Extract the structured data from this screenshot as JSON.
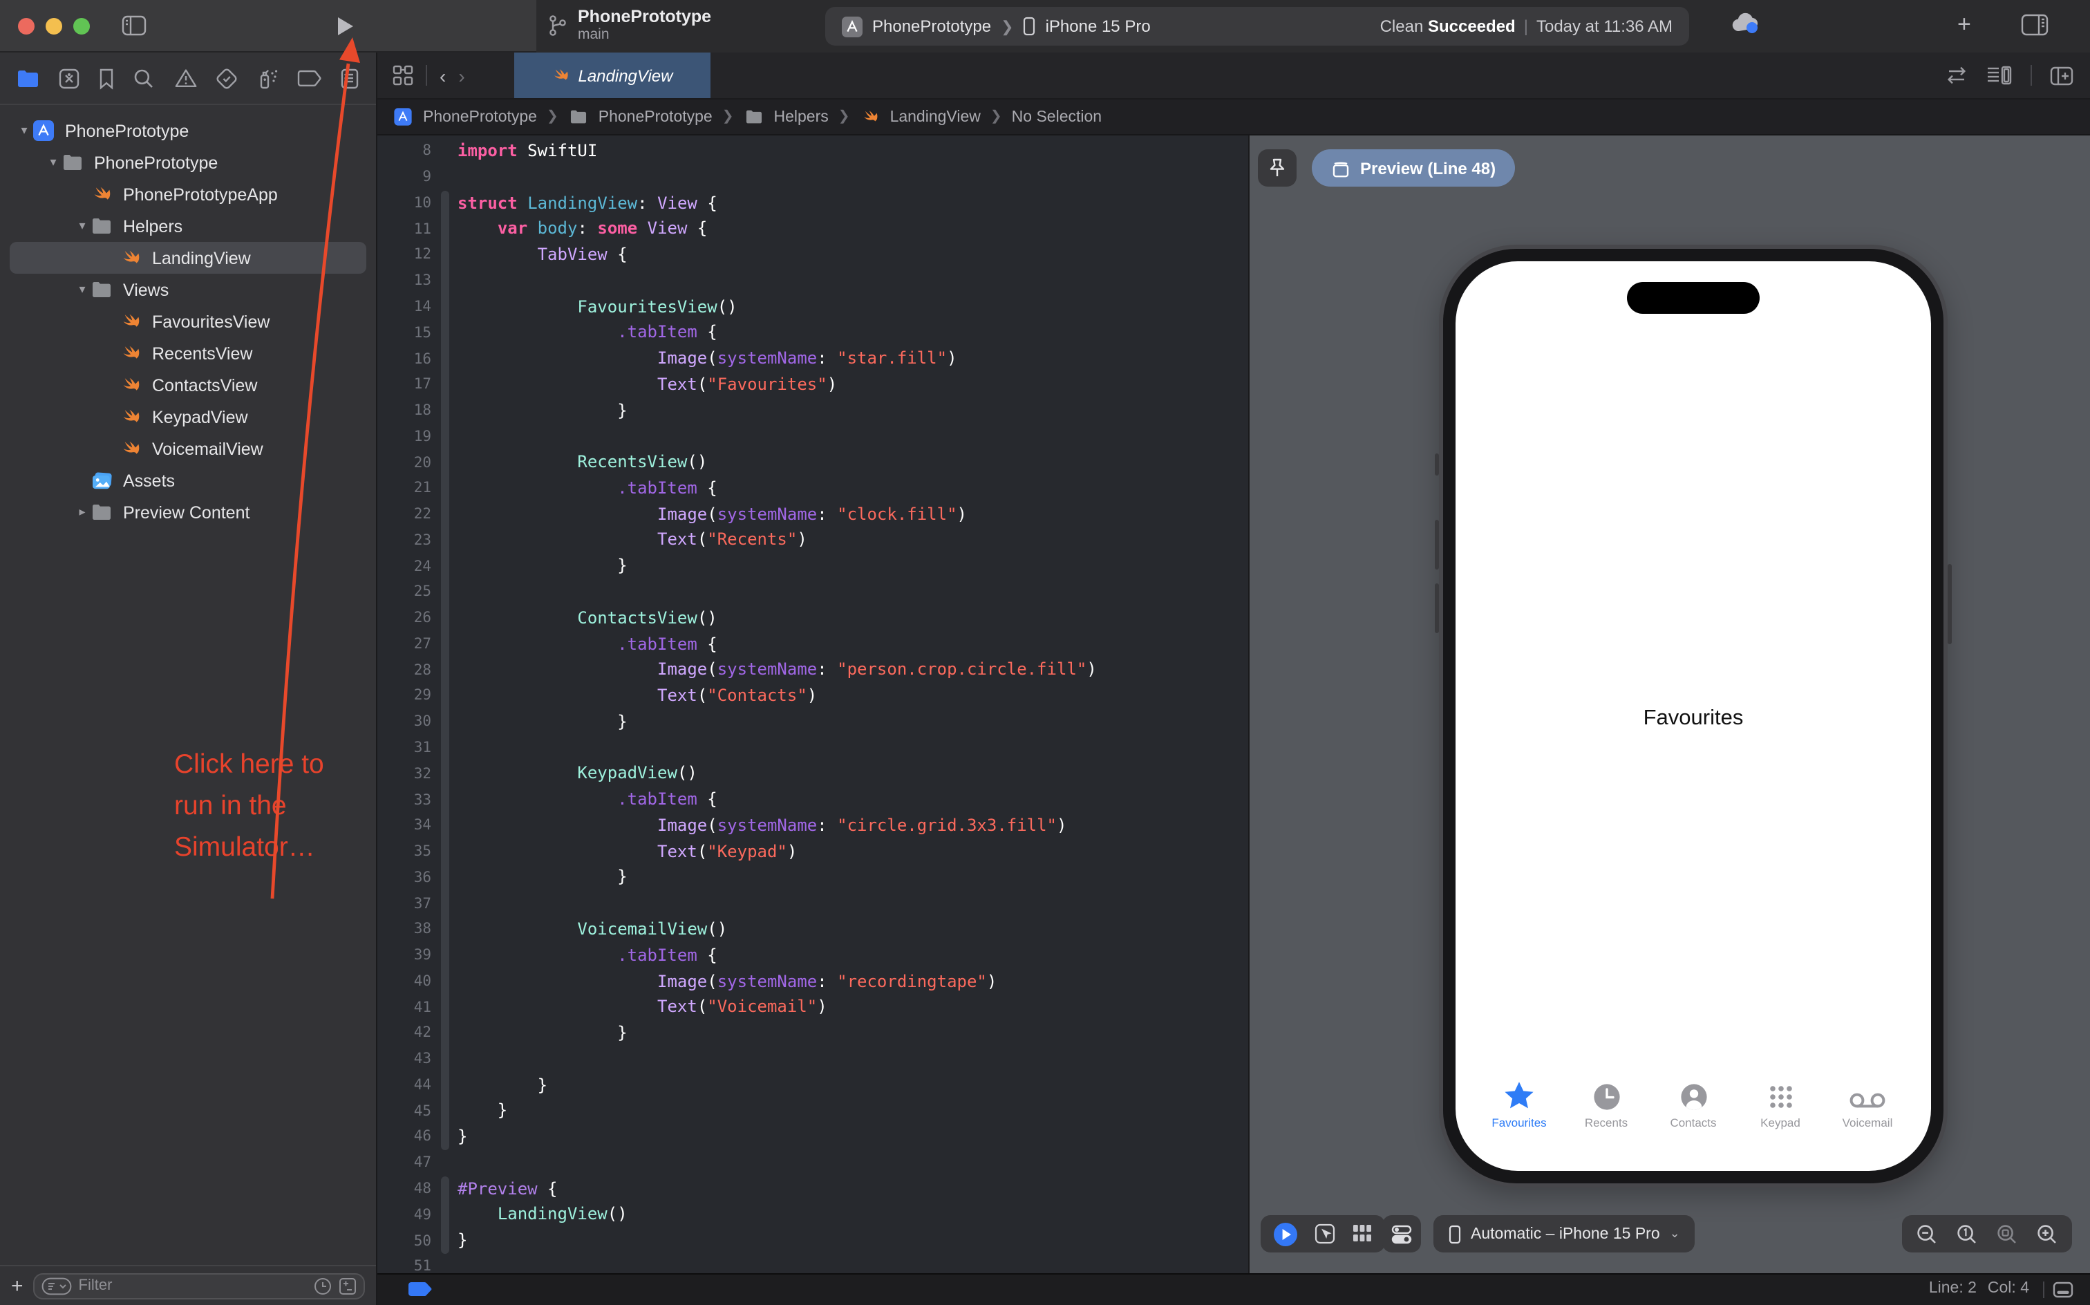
{
  "window": {
    "title": "PhonePrototype",
    "branch": "main",
    "scheme": {
      "project": "PhonePrototype",
      "destination": "iPhone 15 Pro"
    },
    "status": {
      "action": "Clean ",
      "result": "Succeeded",
      "time": "Today at 11:36 AM"
    },
    "plus_label": "+"
  },
  "annotation": {
    "line1": "Click here to",
    "line2": "run in the",
    "line3": "Simulator…",
    "color": "#e8432c"
  },
  "navigator": {
    "icons": [
      "project-navigator",
      "source-control",
      "bookmarks",
      "find",
      "issues",
      "tests",
      "debug",
      "breakpoints",
      "reports"
    ],
    "tree": [
      {
        "label": "PhonePrototype",
        "icon": "app",
        "depth": 0,
        "chevron": "down"
      },
      {
        "label": "PhonePrototype",
        "icon": "folder",
        "depth": 1,
        "chevron": "down"
      },
      {
        "label": "PhonePrototypeApp",
        "icon": "swift",
        "depth": 2,
        "chevron": "none"
      },
      {
        "label": "Helpers",
        "icon": "folder",
        "depth": 2,
        "chevron": "down"
      },
      {
        "label": "LandingView",
        "icon": "swift",
        "depth": 3,
        "chevron": "none",
        "selected": true
      },
      {
        "label": "Views",
        "icon": "folder",
        "depth": 2,
        "chevron": "down"
      },
      {
        "label": "FavouritesView",
        "icon": "swift",
        "depth": 3,
        "chevron": "none"
      },
      {
        "label": "RecentsView",
        "icon": "swift",
        "depth": 3,
        "chevron": "none"
      },
      {
        "label": "ContactsView",
        "icon": "swift",
        "depth": 3,
        "chevron": "none"
      },
      {
        "label": "KeypadView",
        "icon": "swift",
        "depth": 3,
        "chevron": "none"
      },
      {
        "label": "VoicemailView",
        "icon": "swift",
        "depth": 3,
        "chevron": "none"
      },
      {
        "label": "Assets",
        "icon": "assets",
        "depth": 2,
        "chevron": "none"
      },
      {
        "label": "Preview Content",
        "icon": "folder",
        "depth": 2,
        "chevron": "right"
      }
    ],
    "filter": {
      "placeholder": "Filter",
      "add_label": "+"
    }
  },
  "editor_tab": {
    "label": "LandingView"
  },
  "breadcrumb": {
    "items": [
      {
        "label": "PhonePrototype",
        "icon": "app"
      },
      {
        "label": "PhonePrototype",
        "icon": "folder"
      },
      {
        "label": "Helpers",
        "icon": "folder"
      },
      {
        "label": "LandingView",
        "icon": "swift"
      },
      {
        "label": "No Selection",
        "icon": "none"
      }
    ]
  },
  "editor": {
    "folds": [
      [
        10,
        46
      ],
      [
        48,
        50
      ]
    ],
    "lines": [
      {
        "n": 8,
        "s": [
          [
            "k",
            "import"
          ],
          [
            "p",
            " SwiftUI"
          ]
        ]
      },
      {
        "n": 9,
        "s": []
      },
      {
        "n": 10,
        "s": [
          [
            "k",
            "struct"
          ],
          [
            "p",
            " "
          ],
          [
            "d",
            "LandingView"
          ],
          [
            "p",
            ": "
          ],
          [
            "t",
            "View"
          ],
          [
            "p",
            " {"
          ]
        ]
      },
      {
        "n": 11,
        "s": [
          [
            "p",
            "    "
          ],
          [
            "k",
            "var"
          ],
          [
            "p",
            " "
          ],
          [
            "d",
            "body"
          ],
          [
            "p",
            ": "
          ],
          [
            "k",
            "some"
          ],
          [
            "p",
            " "
          ],
          [
            "t",
            "View"
          ],
          [
            "p",
            " {"
          ]
        ]
      },
      {
        "n": 12,
        "s": [
          [
            "p",
            "        "
          ],
          [
            "t",
            "TabView"
          ],
          [
            "p",
            " {"
          ]
        ]
      },
      {
        "n": 13,
        "s": []
      },
      {
        "n": 14,
        "s": [
          [
            "p",
            "            "
          ],
          [
            "j",
            "FavouritesView"
          ],
          [
            "p",
            "()"
          ]
        ]
      },
      {
        "n": 15,
        "s": [
          [
            "p",
            "                "
          ],
          [
            "f",
            ".tabItem"
          ],
          [
            "p",
            " {"
          ]
        ]
      },
      {
        "n": 16,
        "s": [
          [
            "p",
            "                    "
          ],
          [
            "t",
            "Image"
          ],
          [
            "p",
            "("
          ],
          [
            "f",
            "systemName"
          ],
          [
            "p",
            ": "
          ],
          [
            "s",
            "\"star.fill\""
          ],
          [
            "p",
            ")"
          ]
        ]
      },
      {
        "n": 17,
        "s": [
          [
            "p",
            "                    "
          ],
          [
            "t",
            "Text"
          ],
          [
            "p",
            "("
          ],
          [
            "s",
            "\"Favourites\""
          ],
          [
            "p",
            ")"
          ]
        ]
      },
      {
        "n": 18,
        "s": [
          [
            "p",
            "                }"
          ]
        ]
      },
      {
        "n": 19,
        "s": []
      },
      {
        "n": 20,
        "s": [
          [
            "p",
            "            "
          ],
          [
            "j",
            "RecentsView"
          ],
          [
            "p",
            "()"
          ]
        ]
      },
      {
        "n": 21,
        "s": [
          [
            "p",
            "                "
          ],
          [
            "f",
            ".tabItem"
          ],
          [
            "p",
            " {"
          ]
        ]
      },
      {
        "n": 22,
        "s": [
          [
            "p",
            "                    "
          ],
          [
            "t",
            "Image"
          ],
          [
            "p",
            "("
          ],
          [
            "f",
            "systemName"
          ],
          [
            "p",
            ": "
          ],
          [
            "s",
            "\"clock.fill\""
          ],
          [
            "p",
            ")"
          ]
        ]
      },
      {
        "n": 23,
        "s": [
          [
            "p",
            "                    "
          ],
          [
            "t",
            "Text"
          ],
          [
            "p",
            "("
          ],
          [
            "s",
            "\"Recents\""
          ],
          [
            "p",
            ")"
          ]
        ]
      },
      {
        "n": 24,
        "s": [
          [
            "p",
            "                }"
          ]
        ]
      },
      {
        "n": 25,
        "s": []
      },
      {
        "n": 26,
        "s": [
          [
            "p",
            "            "
          ],
          [
            "j",
            "ContactsView"
          ],
          [
            "p",
            "()"
          ]
        ]
      },
      {
        "n": 27,
        "s": [
          [
            "p",
            "                "
          ],
          [
            "f",
            ".tabItem"
          ],
          [
            "p",
            " {"
          ]
        ]
      },
      {
        "n": 28,
        "s": [
          [
            "p",
            "                    "
          ],
          [
            "t",
            "Image"
          ],
          [
            "p",
            "("
          ],
          [
            "f",
            "systemName"
          ],
          [
            "p",
            ": "
          ],
          [
            "s",
            "\"person.crop.circle.fill\""
          ],
          [
            "p",
            ")"
          ]
        ]
      },
      {
        "n": 29,
        "s": [
          [
            "p",
            "                    "
          ],
          [
            "t",
            "Text"
          ],
          [
            "p",
            "("
          ],
          [
            "s",
            "\"Contacts\""
          ],
          [
            "p",
            ")"
          ]
        ]
      },
      {
        "n": 30,
        "s": [
          [
            "p",
            "                }"
          ]
        ]
      },
      {
        "n": 31,
        "s": []
      },
      {
        "n": 32,
        "s": [
          [
            "p",
            "            "
          ],
          [
            "j",
            "KeypadView"
          ],
          [
            "p",
            "()"
          ]
        ]
      },
      {
        "n": 33,
        "s": [
          [
            "p",
            "                "
          ],
          [
            "f",
            ".tabItem"
          ],
          [
            "p",
            " {"
          ]
        ]
      },
      {
        "n": 34,
        "s": [
          [
            "p",
            "                    "
          ],
          [
            "t",
            "Image"
          ],
          [
            "p",
            "("
          ],
          [
            "f",
            "systemName"
          ],
          [
            "p",
            ": "
          ],
          [
            "s",
            "\"circle.grid.3x3.fill\""
          ],
          [
            "p",
            ")"
          ]
        ]
      },
      {
        "n": 35,
        "s": [
          [
            "p",
            "                    "
          ],
          [
            "t",
            "Text"
          ],
          [
            "p",
            "("
          ],
          [
            "s",
            "\"Keypad\""
          ],
          [
            "p",
            ")"
          ]
        ]
      },
      {
        "n": 36,
        "s": [
          [
            "p",
            "                }"
          ]
        ]
      },
      {
        "n": 37,
        "s": []
      },
      {
        "n": 38,
        "s": [
          [
            "p",
            "            "
          ],
          [
            "j",
            "VoicemailView"
          ],
          [
            "p",
            "()"
          ]
        ]
      },
      {
        "n": 39,
        "s": [
          [
            "p",
            "                "
          ],
          [
            "f",
            ".tabItem"
          ],
          [
            "p",
            " {"
          ]
        ]
      },
      {
        "n": 40,
        "s": [
          [
            "p",
            "                    "
          ],
          [
            "t",
            "Image"
          ],
          [
            "p",
            "("
          ],
          [
            "f",
            "systemName"
          ],
          [
            "p",
            ": "
          ],
          [
            "s",
            "\"recordingtape\""
          ],
          [
            "p",
            ")"
          ]
        ]
      },
      {
        "n": 41,
        "s": [
          [
            "p",
            "                    "
          ],
          [
            "t",
            "Text"
          ],
          [
            "p",
            "("
          ],
          [
            "s",
            "\"Voicemail\""
          ],
          [
            "p",
            ")"
          ]
        ]
      },
      {
        "n": 42,
        "s": [
          [
            "p",
            "                }"
          ]
        ]
      },
      {
        "n": 43,
        "s": []
      },
      {
        "n": 44,
        "s": [
          [
            "p",
            "        }"
          ]
        ]
      },
      {
        "n": 45,
        "s": [
          [
            "p",
            "    }"
          ]
        ]
      },
      {
        "n": 46,
        "s": [
          [
            "p",
            "}"
          ]
        ]
      },
      {
        "n": 47,
        "s": []
      },
      {
        "n": 48,
        "s": [
          [
            "m",
            "#Preview"
          ],
          [
            "p",
            " {"
          ]
        ]
      },
      {
        "n": 49,
        "s": [
          [
            "p",
            "    "
          ],
          [
            "j",
            "LandingView"
          ],
          [
            "p",
            "()"
          ]
        ]
      },
      {
        "n": 50,
        "s": [
          [
            "p",
            "}"
          ]
        ]
      },
      {
        "n": 51,
        "s": []
      }
    ]
  },
  "canvas": {
    "preview_button": "Preview (Line 48)",
    "device_selector": "Automatic – iPhone 15 Pro",
    "controls": [
      "live-preview",
      "selectable-mode",
      "variants-mode",
      "device-settings"
    ],
    "zoom_controls": [
      "zoom-out",
      "zoom-actual-size",
      "zoom-to-fit",
      "zoom-in"
    ]
  },
  "phone": {
    "center_label": "Favourites",
    "accent": "#2e7cf6",
    "tabs": [
      {
        "label": "Favourites",
        "icon": "star",
        "active": true
      },
      {
        "label": "Recents",
        "icon": "clock",
        "active": false
      },
      {
        "label": "Contacts",
        "icon": "person",
        "active": false
      },
      {
        "label": "Keypad",
        "icon": "keypad",
        "active": false
      },
      {
        "label": "Voicemail",
        "icon": "voicemail",
        "active": false
      }
    ]
  },
  "statusbar": {
    "line": "Line: 2",
    "col": "Col: 4"
  }
}
